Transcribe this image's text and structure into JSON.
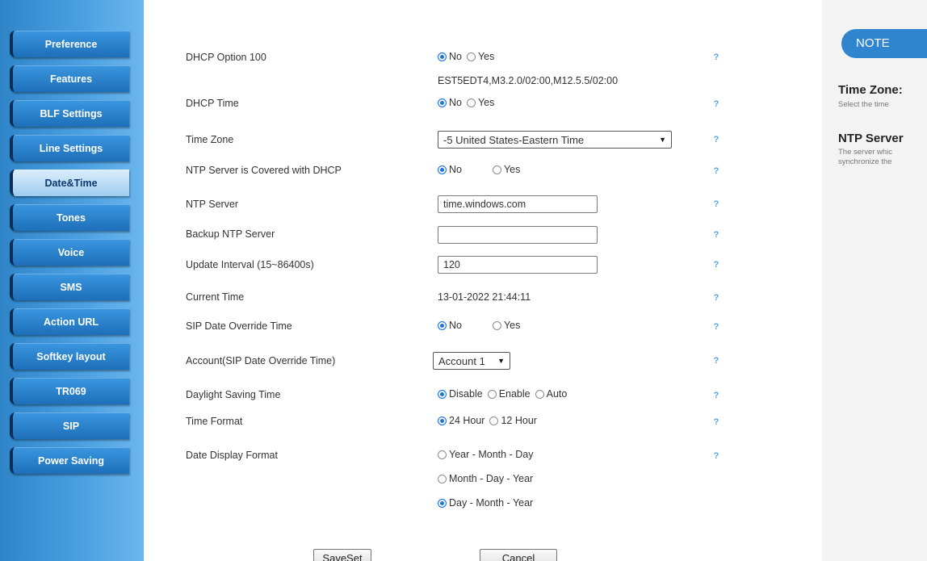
{
  "sidebar": {
    "items": [
      {
        "label": "Preference"
      },
      {
        "label": "Features"
      },
      {
        "label": "BLF Settings"
      },
      {
        "label": "Line Settings"
      },
      {
        "label": "Date&Time"
      },
      {
        "label": "Tones"
      },
      {
        "label": "Voice"
      },
      {
        "label": "SMS"
      },
      {
        "label": "Action URL"
      },
      {
        "label": "Softkey layout"
      },
      {
        "label": "TR069"
      },
      {
        "label": "SIP"
      },
      {
        "label": "Power Saving"
      }
    ],
    "active": "Date&Time"
  },
  "form": {
    "dhcp_option_100": {
      "label": "DHCP Option 100",
      "options": [
        "No",
        "Yes"
      ],
      "selected": "No",
      "help": "?"
    },
    "dhcp_time_value": "EST5EDT4,M3.2.0/02:00,M12.5.5/02:00",
    "dhcp_time": {
      "label": "DHCP Time",
      "options": [
        "No",
        "Yes"
      ],
      "selected": "No",
      "help": "?"
    },
    "time_zone": {
      "label": "Time Zone",
      "value": "-5 United States-Eastern Time",
      "help": "?"
    },
    "ntp_covered_dhcp": {
      "label": "NTP Server is Covered with DHCP",
      "options": [
        "No",
        "Yes"
      ],
      "selected": "No",
      "help": "?"
    },
    "ntp_server": {
      "label": "NTP Server",
      "value": "time.windows.com",
      "help": "?"
    },
    "backup_ntp_server": {
      "label": "Backup NTP Server",
      "value": "",
      "help": "?"
    },
    "update_interval": {
      "label": "Update Interval (15~86400s)",
      "value": "120",
      "help": "?"
    },
    "current_time": {
      "label": "Current Time",
      "value": "13-01-2022 21:44:11",
      "help": "?"
    },
    "sip_date_override": {
      "label": "SIP Date Override Time",
      "options": [
        "No",
        "Yes"
      ],
      "selected": "No",
      "help": "?"
    },
    "account": {
      "label": "Account(SIP Date Override Time)",
      "value": "Account 1",
      "help": "?"
    },
    "daylight_saving": {
      "label": "Daylight Saving Time",
      "options": [
        "Disable",
        "Enable",
        "Auto"
      ],
      "selected": "Disable",
      "help": "?"
    },
    "time_format": {
      "label": "Time Format",
      "options": [
        "24 Hour",
        "12 Hour"
      ],
      "selected": "24 Hour",
      "help": "?"
    },
    "date_display_format": {
      "label": "Date Display Format",
      "options": [
        "Year - Month - Day",
        "Month - Day - Year",
        "Day - Month - Year"
      ],
      "selected": "Day - Month - Year",
      "help": "?"
    }
  },
  "buttons": {
    "save": "SaveSet",
    "cancel": "Cancel"
  },
  "note": {
    "badge": "NOTE",
    "sections": [
      {
        "title": "Time Zone:",
        "text": [
          "Select the time"
        ]
      },
      {
        "title": "NTP Server",
        "text": [
          "The server whic",
          "synchronize the"
        ]
      }
    ]
  },
  "colors": {
    "accent": "#2f86cf",
    "radio_selected": "#1a73e8",
    "sidebar": "#2f85c8",
    "sidebar_border": "#0c2f5a"
  }
}
